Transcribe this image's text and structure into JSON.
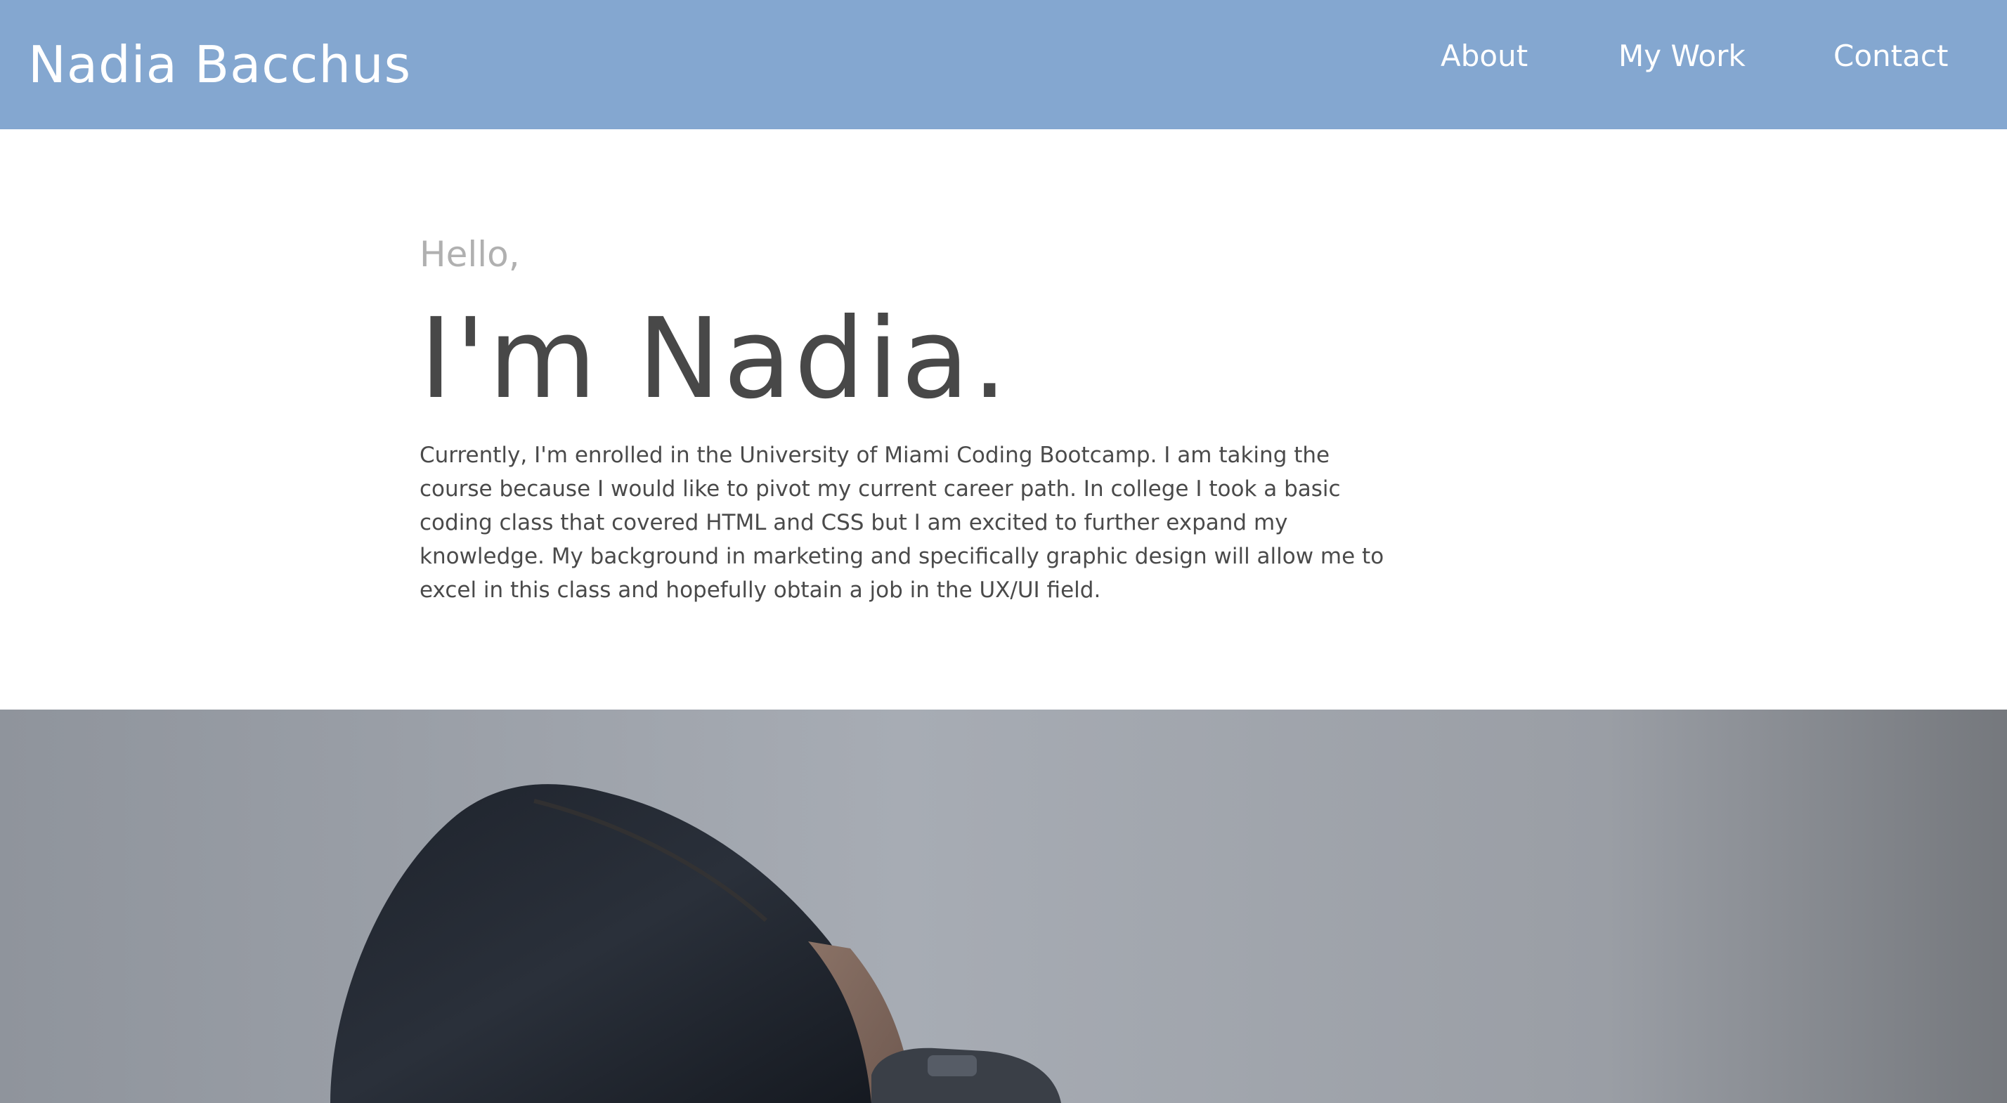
{
  "header": {
    "site_title": "Nadia Bacchus",
    "nav": {
      "about": "About",
      "my_work": "My Work",
      "contact": "Contact"
    },
    "background_color": "#84a7d0"
  },
  "intro": {
    "greeting": "Hello,",
    "headline": "I'm Nadia.",
    "bio": "Currently, I'm enrolled in the University of Miami Coding Bootcamp. I am taking the course because I would like to pivot my current career path. In college I took a basic coding class that covered HTML and CSS but I am excited to further expand my knowledge. My background in marketing and specifically graphic design will allow me to excel in this class and hopefully obtain a job in the UX/UI field."
  },
  "hero_photo": {
    "subject": "woman-with-camera-photo"
  }
}
